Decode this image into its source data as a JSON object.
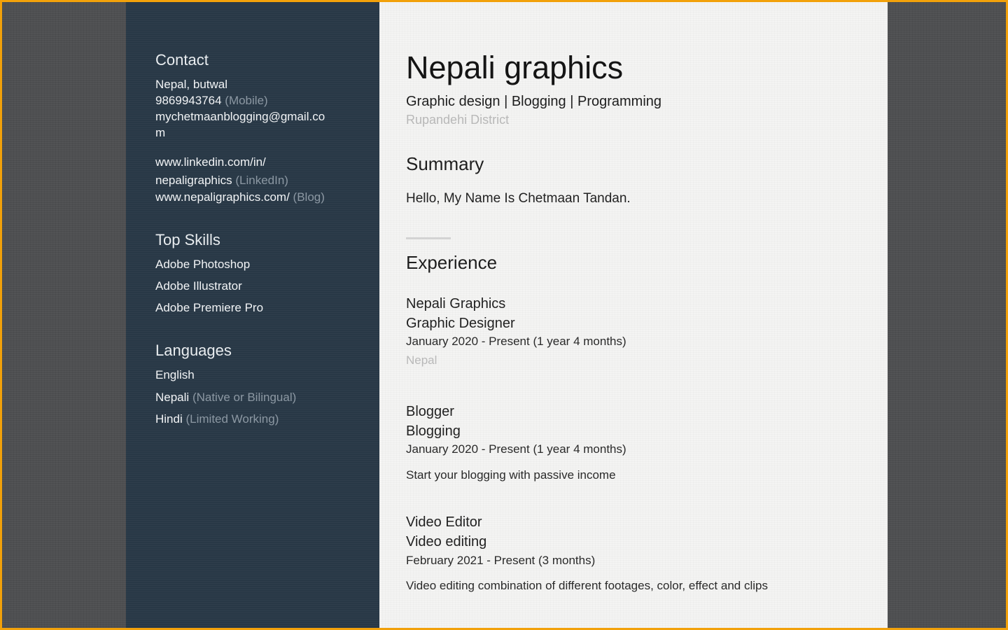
{
  "sidebar": {
    "contact": {
      "heading": "Contact",
      "location": "Nepal, butwal",
      "phone": "9869943764",
      "phone_label": "(Mobile)",
      "email_line1": "mychetmaanblogging@gmail.co",
      "email_line2": "m",
      "linkedin_line1": "www.linkedin.com/in/",
      "linkedin_line2": "nepaligraphics",
      "linkedin_label": "(LinkedIn)",
      "blog": "www.nepaligraphics.com/",
      "blog_label": "(Blog)"
    },
    "skills": {
      "heading": "Top Skills",
      "items": [
        "Adobe Photoshop",
        "Adobe Illustrator",
        "Adobe Premiere Pro"
      ]
    },
    "languages": {
      "heading": "Languages",
      "items": [
        {
          "name": "English",
          "level": ""
        },
        {
          "name": "Nepali",
          "level": "(Native or Bilingual)"
        },
        {
          "name": "Hindi",
          "level": "(Limited Working)"
        }
      ]
    }
  },
  "main": {
    "name": "Nepali graphics",
    "headline": "Graphic design | Blogging | Programming",
    "location": "Rupandehi District",
    "summary": {
      "heading": "Summary",
      "text": "Hello, My Name Is Chetmaan Tandan."
    },
    "experience": {
      "heading": "Experience",
      "items": [
        {
          "company": "Nepali Graphics",
          "role": "Graphic Designer",
          "dates": "January 2020 - Present (1 year 4 months)",
          "location": "Nepal",
          "description": ""
        },
        {
          "company": "Blogger",
          "role": "Blogging",
          "dates": "January 2020 - Present (1 year 4 months)",
          "location": "",
          "description": "Start your blogging with passive income"
        },
        {
          "company": "Video Editor",
          "role": "Video editing",
          "dates": "February 2021 - Present (3 months)",
          "location": "",
          "description": "Video editing combination of different footages, color, effect and clips"
        }
      ]
    }
  }
}
